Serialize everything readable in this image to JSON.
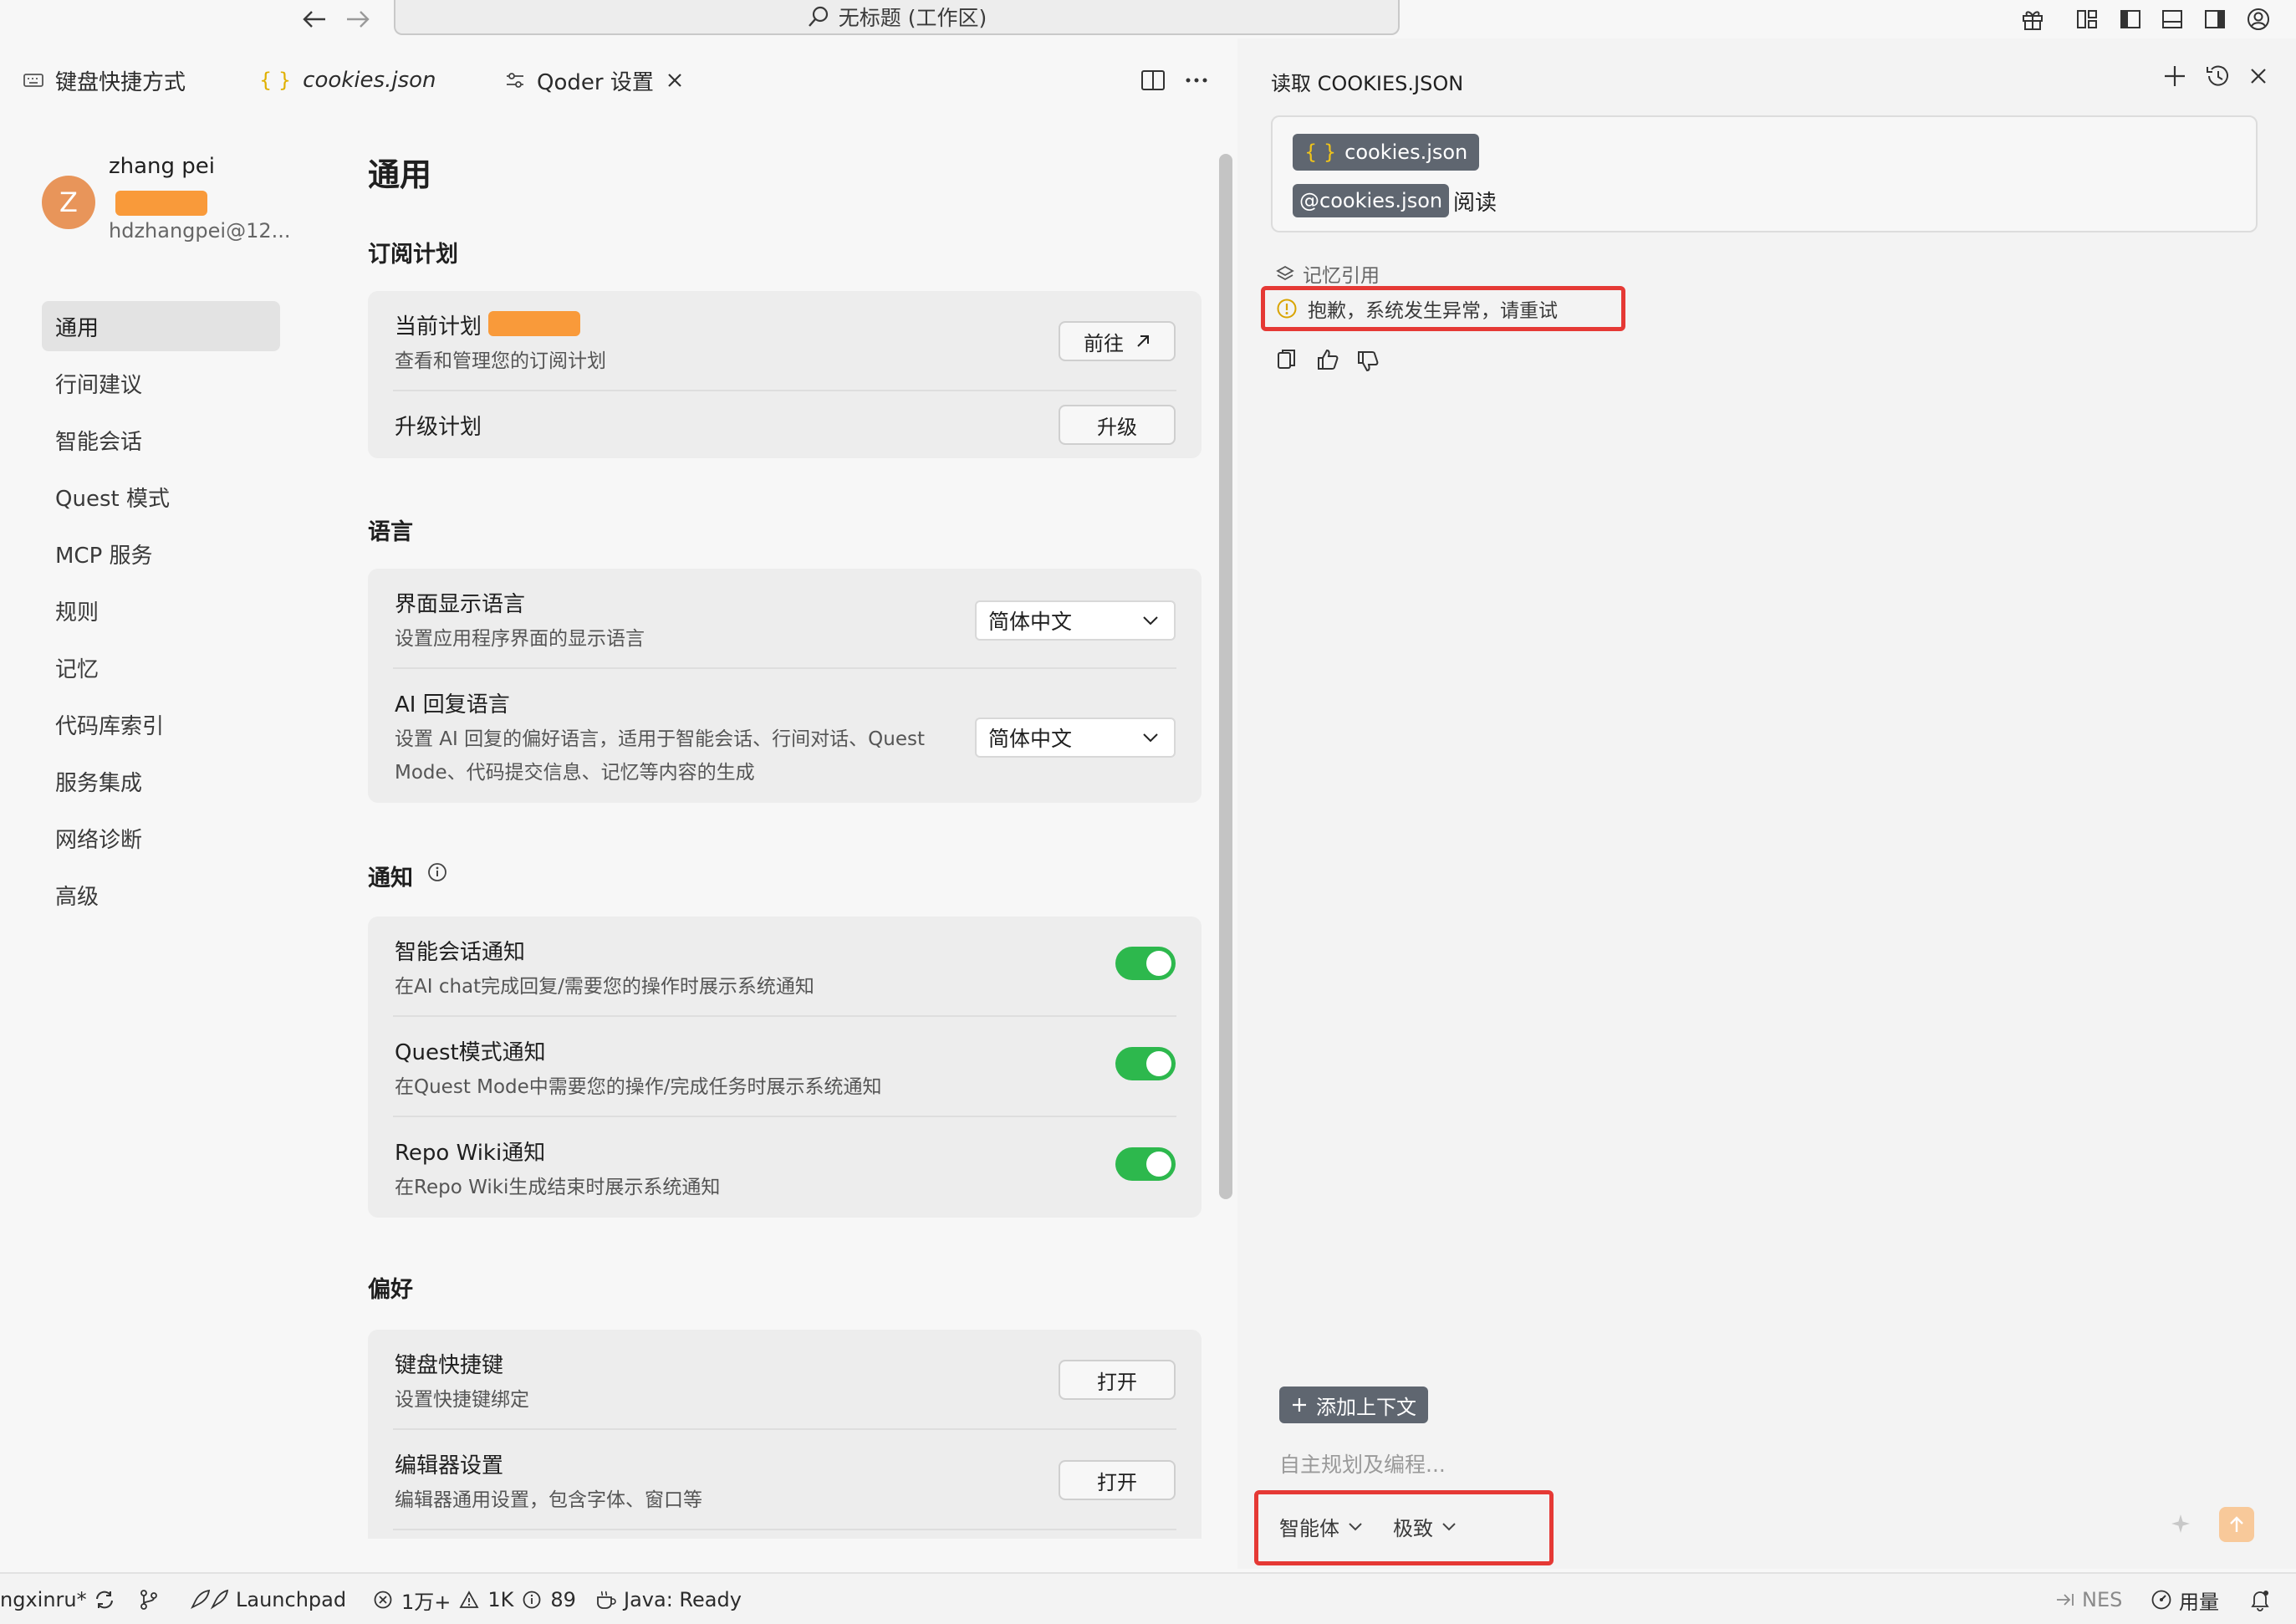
{
  "titlebar": {
    "search_text": "无标题 (工作区)"
  },
  "tabs": [
    {
      "label": "键盘快捷方式"
    },
    {
      "label": "cookies.json"
    },
    {
      "label": "Qoder 设置"
    }
  ],
  "profile": {
    "avatar_letter": "Z",
    "name": "zhang pei",
    "email": "hdzhangpei@12..."
  },
  "sidebar": {
    "items": [
      {
        "label": "通用"
      },
      {
        "label": "行间建议"
      },
      {
        "label": "智能会话"
      },
      {
        "label": "Quest 模式"
      },
      {
        "label": "MCP 服务"
      },
      {
        "label": "规则"
      },
      {
        "label": "记忆"
      },
      {
        "label": "代码库索引"
      },
      {
        "label": "服务集成"
      },
      {
        "label": "网络诊断"
      },
      {
        "label": "高级"
      }
    ]
  },
  "settings": {
    "title": "通用",
    "subscription": {
      "heading": "订阅计划",
      "current_plan": "当前计划",
      "current_plan_desc": "查看和管理您的订阅计划",
      "goto_label": "前往",
      "upgrade_plan": "升级计划",
      "upgrade_label": "升级"
    },
    "language": {
      "heading": "语言",
      "ui_lang": "界面显示语言",
      "ui_lang_desc": "设置应用程序界面的显示语言",
      "ui_lang_value": "简体中文",
      "ai_lang": "AI 回复语言",
      "ai_lang_desc_1": "设置 AI 回复的偏好语言，适用于智能会话、行间对话、Quest",
      "ai_lang_desc_2": "Mode、代码提交信息、记忆等内容的生成",
      "ai_lang_value": "简体中文"
    },
    "notifications": {
      "heading": "通知",
      "items": [
        {
          "title": "智能会话通知",
          "desc": "在AI chat完成回复/需要您的操作时展示系统通知",
          "enabled": true
        },
        {
          "title": "Quest模式通知",
          "desc": "在Quest Mode中需要您的操作/完成任务时展示系统通知",
          "enabled": true
        },
        {
          "title": "Repo Wiki通知",
          "desc": "在Repo Wiki生成结束时展示系统通知",
          "enabled": true
        }
      ]
    },
    "preferences": {
      "heading": "偏好",
      "keyboard": "键盘快捷键",
      "keyboard_desc": "设置快捷键绑定",
      "keyboard_btn": "打开",
      "editor": "编辑器设置",
      "editor_desc": "编辑器通用设置，包含字体、窗口等",
      "editor_btn": "打开"
    }
  },
  "chat": {
    "title": "读取 COOKIES.JSON",
    "file_chip": "cookies.json",
    "mention_chip": "@cookies.json",
    "message_text": "阅读",
    "memory_ref": "记忆引用",
    "error_text": "抱歉，系统发生异常，请重试",
    "add_context": "添加上下文",
    "input_placeholder": "自主规划及编程...",
    "mode_label": "智能体",
    "model_label": "极致"
  },
  "statusbar": {
    "branch": "ngxinru*",
    "launchpad": "Launchpad",
    "errors": "1万+",
    "warnings": "1K",
    "infos": "89",
    "java": "Java: Ready",
    "nes": "NES",
    "usage": "用量"
  },
  "colors": {
    "accent_toggle": "#2db84d",
    "plan_badge": "#f99a3a",
    "highlight_box": "#e53935",
    "chip_bg": "#5f6670"
  }
}
